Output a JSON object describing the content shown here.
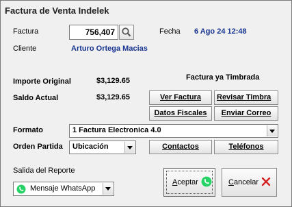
{
  "title": "Factura de Venta Indelek",
  "factura": {
    "label": "Factura",
    "value": "756,407"
  },
  "fecha": {
    "label": "Fecha",
    "value": "6 Ago 24 12:48"
  },
  "cliente": {
    "label": "Cliente",
    "value": "Arturo Ortega Macias"
  },
  "importe_original": {
    "label": "Importe Original",
    "value": "$3,129.65"
  },
  "saldo_actual": {
    "label": "Saldo Actual",
    "value": "$3,129.65"
  },
  "status": "Factura ya Timbrada",
  "buttons": {
    "ver_factura": "Ver Factura",
    "revisar_timbrado": "Revisar Timbra",
    "datos_fiscales": "Datos Fiscales",
    "enviar_correo": "Enviar Correo",
    "contactos": "Contactos",
    "telefonos": "Teléfonos",
    "aceptar": "Aceptar",
    "cancelar": "Cancelar"
  },
  "formato": {
    "label": "Formato",
    "value": "1 Factura Electronica 4.0"
  },
  "orden_partida": {
    "label": "Orden Partida",
    "value": "Ubicación"
  },
  "salida": {
    "label": "Salida del Reporte",
    "value": "Mensaje WhatsApp"
  },
  "colors": {
    "whatsapp": "#25d366",
    "cancel": "#d42020",
    "accent_text": "#16348f"
  }
}
